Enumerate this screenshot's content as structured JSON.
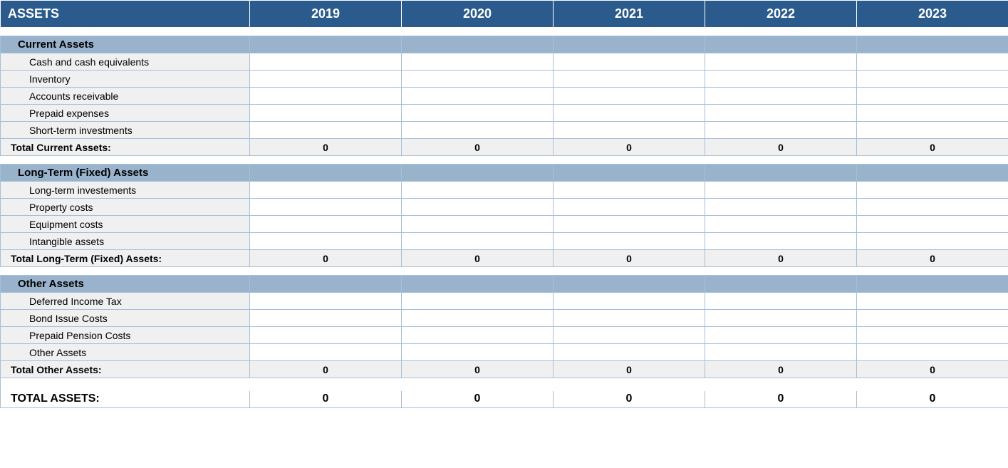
{
  "header": {
    "title": "ASSETS",
    "years": [
      "2019",
      "2020",
      "2021",
      "2022",
      "2023"
    ]
  },
  "sections": [
    {
      "name": "Current Assets",
      "items": [
        {
          "label": "Cash and cash equivalents",
          "values": [
            "",
            "",
            "",
            "",
            ""
          ]
        },
        {
          "label": "Inventory",
          "values": [
            "",
            "",
            "",
            "",
            ""
          ]
        },
        {
          "label": "Accounts receivable",
          "values": [
            "",
            "",
            "",
            "",
            ""
          ]
        },
        {
          "label": "Prepaid expenses",
          "values": [
            "",
            "",
            "",
            "",
            ""
          ]
        },
        {
          "label": "Short-term investments",
          "values": [
            "",
            "",
            "",
            "",
            ""
          ]
        }
      ],
      "subtotal": {
        "label": "Total Current Assets:",
        "values": [
          "0",
          "0",
          "0",
          "0",
          "0"
        ]
      }
    },
    {
      "name": "Long-Term (Fixed) Assets",
      "items": [
        {
          "label": "Long-term investements",
          "values": [
            "",
            "",
            "",
            "",
            ""
          ]
        },
        {
          "label": "Property costs",
          "values": [
            "",
            "",
            "",
            "",
            ""
          ]
        },
        {
          "label": "Equipment costs",
          "values": [
            "",
            "",
            "",
            "",
            ""
          ]
        },
        {
          "label": "Intangible assets",
          "values": [
            "",
            "",
            "",
            "",
            ""
          ]
        }
      ],
      "subtotal": {
        "label": "Total Long-Term (Fixed) Assets:",
        "values": [
          "0",
          "0",
          "0",
          "0",
          "0"
        ]
      }
    },
    {
      "name": "Other Assets",
      "items": [
        {
          "label": "Deferred Income Tax",
          "values": [
            "",
            "",
            "",
            "",
            ""
          ]
        },
        {
          "label": "Bond Issue Costs",
          "values": [
            "",
            "",
            "",
            "",
            ""
          ]
        },
        {
          "label": "Prepaid Pension Costs",
          "values": [
            "",
            "",
            "",
            "",
            ""
          ]
        },
        {
          "label": "Other Assets",
          "values": [
            "",
            "",
            "",
            "",
            ""
          ]
        }
      ],
      "subtotal": {
        "label": "Total Other Assets:",
        "values": [
          "0",
          "0",
          "0",
          "0",
          "0"
        ]
      }
    }
  ],
  "grand_total": {
    "label": "TOTAL ASSETS:",
    "values": [
      "0",
      "0",
      "0",
      "0",
      "0"
    ]
  }
}
